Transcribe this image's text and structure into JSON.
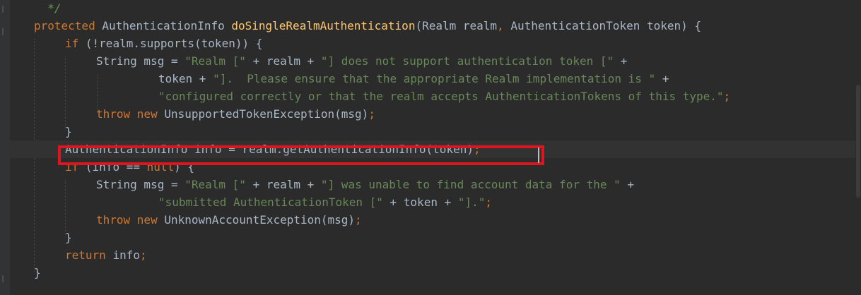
{
  "editor": {
    "lines": [
      {
        "tokens": [
          {
            "cls": "cmt",
            "text": "  */"
          }
        ]
      },
      {
        "tokens": [
          {
            "cls": "kw",
            "text": "protected "
          },
          {
            "cls": "plain",
            "text": "AuthenticationInfo "
          },
          {
            "cls": "fn",
            "text": "doSingleRealmAuthentication"
          },
          {
            "cls": "plain",
            "text": "(Realm realm"
          },
          {
            "cls": "kw",
            "text": ", "
          },
          {
            "cls": "plain",
            "text": "AuthenticationToken token) {"
          }
        ]
      },
      {
        "tokens": [
          {
            "cls": "kw",
            "text": "if "
          },
          {
            "cls": "plain",
            "text": "(!realm.supports(token)) {"
          }
        ]
      },
      {
        "tokens": [
          {
            "cls": "plain",
            "text": "String msg = "
          },
          {
            "cls": "str",
            "text": "\"Realm [\""
          },
          {
            "cls": "plain",
            "text": " + realm + "
          },
          {
            "cls": "str",
            "text": "\"] does not support authentication token [\""
          },
          {
            "cls": "plain",
            "text": " +"
          }
        ]
      },
      {
        "tokens": [
          {
            "cls": "plain",
            "text": "token + "
          },
          {
            "cls": "str",
            "text": "\"].  Please ensure that the appropriate Realm implementation is \""
          },
          {
            "cls": "plain",
            "text": " +"
          }
        ]
      },
      {
        "tokens": [
          {
            "cls": "str",
            "text": "\"configured correctly or that the realm accepts AuthenticationTokens of this type.\""
          },
          {
            "cls": "kw",
            "text": ";"
          }
        ]
      },
      {
        "tokens": [
          {
            "cls": "kw",
            "text": "throw new "
          },
          {
            "cls": "plain",
            "text": "UnsupportedTokenException(msg)"
          },
          {
            "cls": "kw",
            "text": ";"
          }
        ]
      },
      {
        "tokens": [
          {
            "cls": "plain",
            "text": "}"
          }
        ]
      },
      {
        "tokens": [
          {
            "cls": "plain",
            "text": "AuthenticationInfo info = realm.getAuthenticationInfo(token)"
          },
          {
            "cls": "kw",
            "text": ";"
          }
        ]
      },
      {
        "tokens": [
          {
            "cls": "kw",
            "text": "if "
          },
          {
            "cls": "plain",
            "text": "(info == "
          },
          {
            "cls": "kw",
            "text": "null"
          },
          {
            "cls": "plain",
            "text": ") {"
          }
        ]
      },
      {
        "tokens": [
          {
            "cls": "plain",
            "text": "String msg = "
          },
          {
            "cls": "str",
            "text": "\"Realm [\""
          },
          {
            "cls": "plain",
            "text": " + realm + "
          },
          {
            "cls": "str",
            "text": "\"] was unable to find account data for the \""
          },
          {
            "cls": "plain",
            "text": " +"
          }
        ]
      },
      {
        "tokens": [
          {
            "cls": "str",
            "text": "\"submitted AuthenticationToken [\""
          },
          {
            "cls": "plain",
            "text": " + token + "
          },
          {
            "cls": "str",
            "text": "\"].\""
          },
          {
            "cls": "kw",
            "text": ";"
          }
        ]
      },
      {
        "tokens": [
          {
            "cls": "kw",
            "text": "throw new "
          },
          {
            "cls": "plain",
            "text": "UnknownAccountException(msg)"
          },
          {
            "cls": "kw",
            "text": ";"
          }
        ]
      },
      {
        "tokens": [
          {
            "cls": "plain",
            "text": "}"
          }
        ]
      },
      {
        "tokens": [
          {
            "cls": "kw",
            "text": "return "
          },
          {
            "cls": "plain",
            "text": "info"
          },
          {
            "cls": "kw",
            "text": ";"
          }
        ]
      },
      {
        "tokens": [
          {
            "cls": "plain",
            "text": "}"
          }
        ]
      }
    ],
    "highlighted_line_index": 8,
    "colors": {
      "background": "#2b2b2b",
      "keyword": "#cc7832",
      "method": "#ffc66d",
      "string": "#6a8759",
      "comment": "#629755",
      "text": "#a9b7c6",
      "annotation_box": "#e0141e"
    }
  }
}
